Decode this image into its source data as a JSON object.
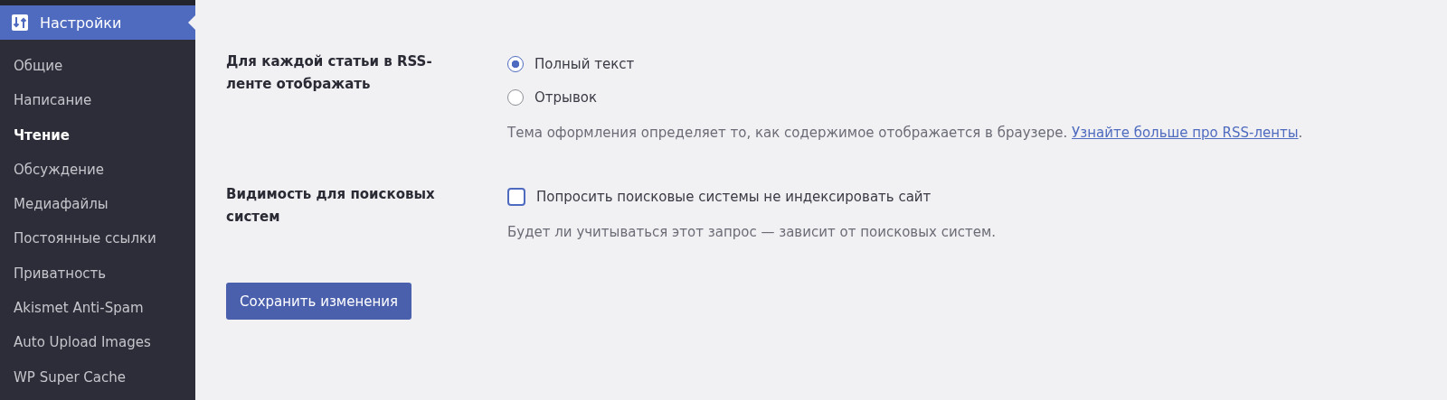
{
  "sidebar": {
    "header": {
      "label": "Настройки",
      "selected": true
    },
    "items": [
      {
        "label": "Общие",
        "selected": false
      },
      {
        "label": "Написание",
        "selected": false
      },
      {
        "label": "Чтение",
        "selected": true
      },
      {
        "label": "Обсуждение",
        "selected": false
      },
      {
        "label": "Медиафайлы",
        "selected": false
      },
      {
        "label": "Постоянные ссылки",
        "selected": false
      },
      {
        "label": "Приватность",
        "selected": false
      },
      {
        "label": "Akismet Anti-Spam",
        "selected": false
      },
      {
        "label": "Auto Upload Images",
        "selected": false
      },
      {
        "label": "WP Super Cache",
        "selected": false
      }
    ]
  },
  "settings": [
    {
      "kind": "radio",
      "label": "Для каждой статьи в RSS-ленте отображать",
      "options": [
        {
          "label": "Полный текст",
          "selected": true
        },
        {
          "label": "Отрывок",
          "selected": false
        }
      ],
      "description": {
        "text": "Тема оформления определяет то, как содержимое отображается в браузере. ",
        "link": "Узнайте больше про RSS-ленты",
        "after": "."
      }
    },
    {
      "kind": "checkbox",
      "label": "Видимость для поисковых систем",
      "options": [
        {
          "label": "Попросить поисковые системы не индексировать сайт",
          "checked": false
        }
      ],
      "description": {
        "text": "Будет ли учитываться этот запрос — зависит от поисковых систем."
      }
    }
  ],
  "save_button": "Сохранить изменения"
}
